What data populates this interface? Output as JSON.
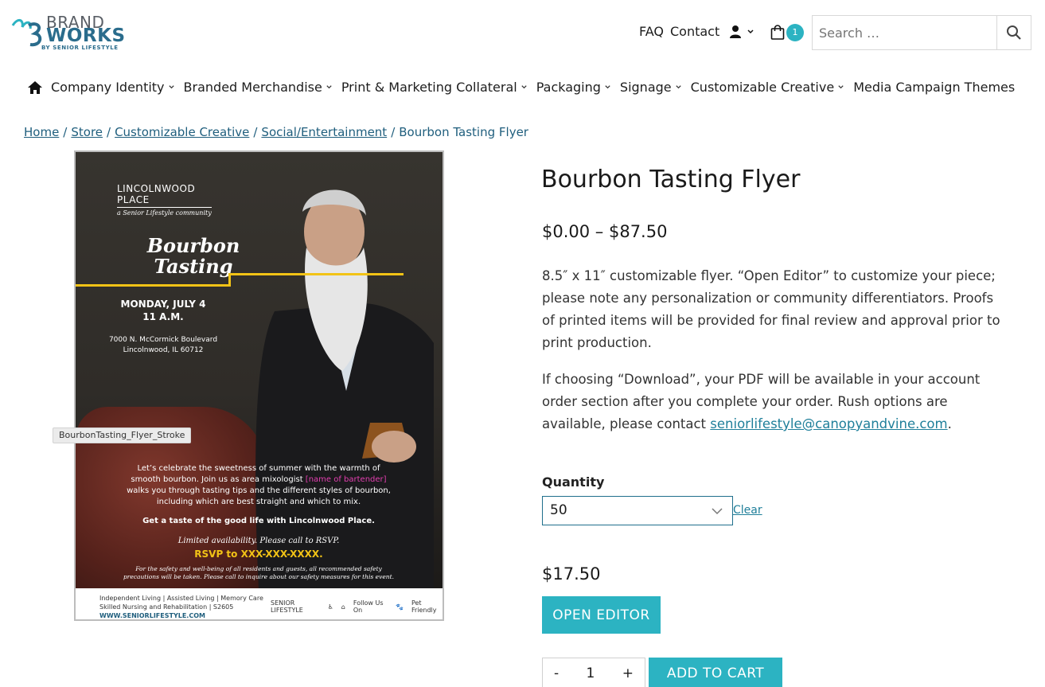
{
  "colors": {
    "accent": "#2cb3c2",
    "link": "#1f5e7d",
    "flyer_yellow": "#f2c316",
    "flyer_pink": "#e33fb0"
  },
  "logo": {
    "line1": "BRAND",
    "line2": "WORKS",
    "line3": "BY SENIOR LIFESTYLE"
  },
  "topnav": {
    "faq": "FAQ",
    "contact": "Contact",
    "cart_count": "1",
    "search_placeholder": "Search …"
  },
  "mainnav": {
    "items": [
      {
        "label": "Company Identity",
        "has_menu": true
      },
      {
        "label": "Branded Merchandise",
        "has_menu": true
      },
      {
        "label": "Print & Marketing Collateral",
        "has_menu": true
      },
      {
        "label": "Packaging",
        "has_menu": true
      },
      {
        "label": "Signage",
        "has_menu": true
      },
      {
        "label": "Customizable Creative",
        "has_menu": true
      },
      {
        "label": "Media Campaign Themes",
        "has_menu": false
      }
    ]
  },
  "breadcrumb": {
    "home": "Home",
    "store": "Store",
    "customizable": "Customizable Creative",
    "social": "Social/Entertainment",
    "current": "Bourbon Tasting Flyer"
  },
  "flyer": {
    "community_line1": "LINCOLNWOOD",
    "community_line2": "PLACE",
    "community_sub": "a Senior Lifestyle community",
    "title_line1": "Bourbon",
    "title_line2": "Tasting",
    "date_line1": "MONDAY, JULY 4",
    "date_line2": "11 A.M.",
    "address_line1": "7000 N. McCormick Boulevard",
    "address_line2": "Lincolnwood, IL 60712",
    "body_a": "Let’s celebrate the sweetness of summer with the warmth of smooth bourbon. Join us as area mixologist ",
    "body_pink": "[name of bartender]",
    "body_b": " walks you through tasting tips and the different styles of bourbon, including which are best straight and which to mix.",
    "tagline": "Get a taste of the good life with Lincolnwood Place.",
    "limited": "Limited availability. Please call to RSVP.",
    "rsvp": "RSVP to XXX-XXX-XXXX.",
    "safety": "For the safety and well-being of all residents and guests, all recommended safety precautions will be taken. Please call to inquire about our safety measures for this event.",
    "footer_line1": "Independent Living | Assisted Living | Memory Care",
    "footer_line2": "Skilled Nursing and Rehabilitation | S2605",
    "footer_url": "WWW.SENIORLIFESTYLE.COM",
    "footer_brand": "SENIOR LIFESTYLE",
    "footer_follow": "Follow Us On",
    "footer_pet": "Pet Friendly"
  },
  "image_tooltip": "BourbonTasting_Flyer_Stroke",
  "product": {
    "title": "Bourbon Tasting Flyer",
    "price_range": "$0.00 – $87.50",
    "desc1": "8.5″ x 11″ customizable flyer. “Open Editor” to customize your piece; please note any personalization or community differentiators. Proofs of printed items will be provided for final review and approval prior to print production.",
    "desc2_a": "If choosing “Download”, your PDF will be available in your account order section after you complete your order. Rush options are available, please contact ",
    "desc2_link": "seniorlifestyle@canopyandvine.com",
    "desc2_b": ".",
    "quantity_label": "Quantity",
    "quantity_value": "50",
    "clear": "Clear",
    "variation_price": "$17.50",
    "open_editor": "OPEN EDITOR",
    "qty_minus": "-",
    "qty_value": "1",
    "qty_plus": "+",
    "add_to_cart": "ADD TO CART"
  }
}
